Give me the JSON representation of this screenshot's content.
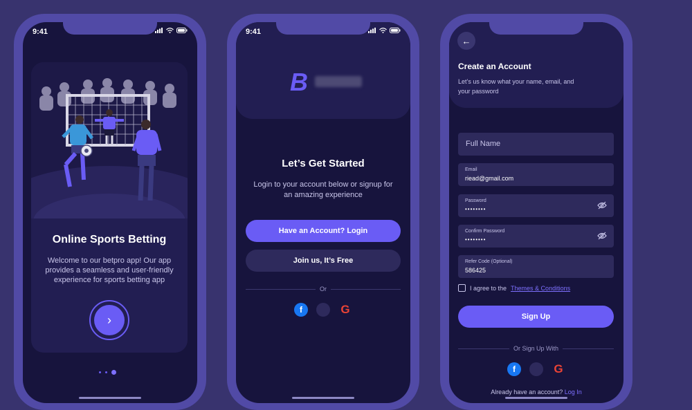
{
  "status_bar": {
    "time": "9:41"
  },
  "onboarding": {
    "title": "Online Sports Betting",
    "description": "Welcome to our betpro app! Our app provides a seamless and user-friendly experience for sports betting app",
    "next_icon": "chevron-right-icon",
    "page_indicator": {
      "total": 3,
      "active": 3
    }
  },
  "start": {
    "logo_letter": "B",
    "title": "Let’s Get Started",
    "description": "Login to your account below or signup for an amazing experience",
    "login_button": "Have an Account? Login",
    "join_button": "Join us, It’s Free",
    "divider": "Or",
    "social_icons": [
      "facebook-icon",
      "apple-icon",
      "google-icon"
    ]
  },
  "signup": {
    "title": "Create an Account",
    "description": "Let’s us know what your name, email, and your password",
    "full_name_placeholder": "Full Name",
    "email_label": "Email",
    "email_value": "riead@gmail.com",
    "password_label": "Password",
    "password_value": "••••••••",
    "confirm_label": "Confirm Password",
    "confirm_value": "••••••••",
    "refer_label": "Refer Code (Optional)",
    "refer_value": "586425",
    "agree_text": "I agree to the",
    "agree_link": "Themes & Conditions",
    "signup_button": "Sign Up",
    "divider": "Or Sign Up With",
    "footer_text": "Already have an account?",
    "footer_link": "Log In"
  },
  "colors": {
    "accent": "#6a5cf5",
    "background": "#38336e",
    "phone_frame": "#514aa6",
    "screen": "#17143d"
  }
}
